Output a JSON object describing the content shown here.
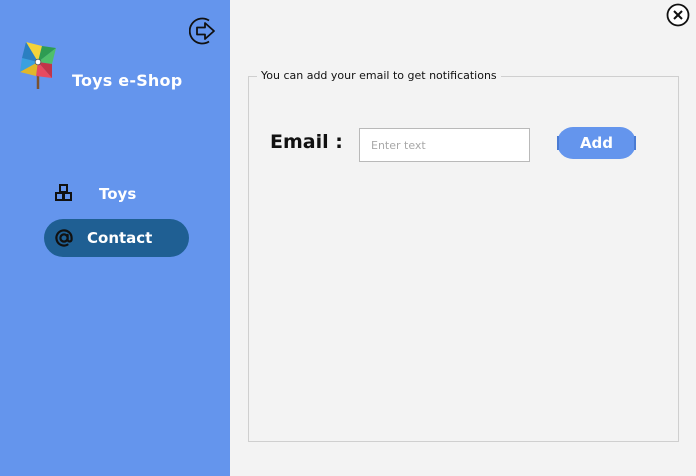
{
  "app": {
    "title": "Toys e-Shop",
    "logo_icon": "pinwheel-icon",
    "logout_icon": "logout-arrow-icon",
    "close_icon": "close-icon"
  },
  "sidebar": {
    "items": [
      {
        "label": "Toys",
        "icon": "blocks-icon",
        "active": false
      },
      {
        "label": "Contact",
        "icon": "at-sign-icon",
        "active": true
      }
    ]
  },
  "main": {
    "group_title": "You can add your email to get notifications",
    "email_label": "Email :",
    "email_placeholder": "Enter text",
    "email_value": "",
    "add_label": "Add"
  },
  "colors": {
    "sidebar": "#6495ed",
    "active_nav": "#1f5f93",
    "add_button": "#6495ed",
    "content_bg": "#f3f3f3"
  }
}
